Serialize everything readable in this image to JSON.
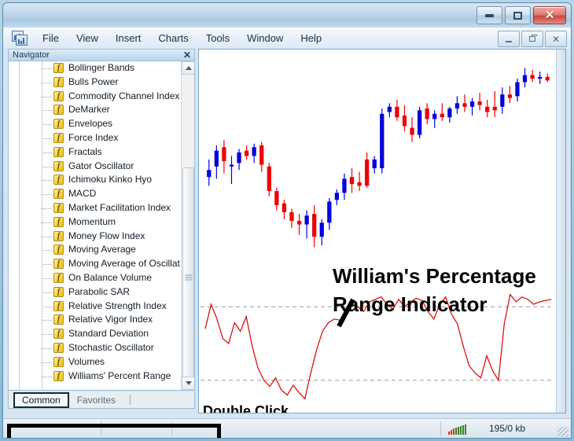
{
  "window": {
    "controls": {
      "minimize": "minimize",
      "maximize": "maximize",
      "close": "✕"
    }
  },
  "menubar": {
    "items": [
      {
        "label": "File"
      },
      {
        "label": "View"
      },
      {
        "label": "Insert"
      },
      {
        "label": "Charts"
      },
      {
        "label": "Tools"
      },
      {
        "label": "Window"
      },
      {
        "label": "Help"
      }
    ],
    "mdi_controls": {
      "minimize": "minimize",
      "restore": "restore",
      "close": "✕"
    }
  },
  "navigator": {
    "title": "Navigator",
    "close_label": "✕",
    "items": [
      {
        "label": "Bollinger Bands",
        "icon": "function-icon"
      },
      {
        "label": "Bulls Power",
        "icon": "function-icon"
      },
      {
        "label": "Commodity Channel Index",
        "icon": "function-icon"
      },
      {
        "label": "DeMarker",
        "icon": "function-icon"
      },
      {
        "label": "Envelopes",
        "icon": "function-icon"
      },
      {
        "label": "Force Index",
        "icon": "function-icon"
      },
      {
        "label": "Fractals",
        "icon": "function-icon"
      },
      {
        "label": "Gator Oscillator",
        "icon": "function-icon"
      },
      {
        "label": "Ichimoku Kinko Hyo",
        "icon": "function-icon"
      },
      {
        "label": "MACD",
        "icon": "function-icon"
      },
      {
        "label": "Market Facilitation Index",
        "icon": "function-icon"
      },
      {
        "label": "Momentum",
        "icon": "function-icon"
      },
      {
        "label": "Money Flow Index",
        "icon": "function-icon"
      },
      {
        "label": "Moving Average",
        "icon": "function-icon"
      },
      {
        "label": "Moving Average of Oscillat",
        "icon": "function-icon"
      },
      {
        "label": "On Balance Volume",
        "icon": "function-icon"
      },
      {
        "label": "Parabolic SAR",
        "icon": "function-icon"
      },
      {
        "label": "Relative Strength Index",
        "icon": "function-icon"
      },
      {
        "label": "Relative Vigor Index",
        "icon": "function-icon"
      },
      {
        "label": "Standard Deviation",
        "icon": "function-icon"
      },
      {
        "label": "Stochastic Oscillator",
        "icon": "function-icon"
      },
      {
        "label": "Volumes",
        "icon": "function-icon"
      },
      {
        "label": "Williams' Percent Range",
        "icon": "function-icon"
      }
    ],
    "tabs": [
      {
        "label": "Common",
        "active": true
      },
      {
        "label": "Favorites",
        "active": false
      }
    ]
  },
  "chart": {
    "annotations": {
      "title": "William's Percentage Range Indicator",
      "double_click": "Double Click"
    },
    "colors": {
      "bullish": "#0000dd",
      "bearish": "#ee0000",
      "indicator_line": "#dd1111",
      "level_line": "#999999"
    }
  },
  "statusbar": {
    "traffic": "195/0 kb"
  },
  "chart_data": {
    "type": "line",
    "title": "William's Percentage Range Indicator",
    "xlabel": "",
    "ylabel": "",
    "panes": [
      {
        "name": "price",
        "type": "candlestick",
        "ylim": [
          0,
          100
        ],
        "candles": [
          {
            "o": 46,
            "h": 56,
            "l": 41,
            "c": 50,
            "dir": "up"
          },
          {
            "o": 52,
            "h": 64,
            "l": 45,
            "c": 61,
            "dir": "up"
          },
          {
            "o": 63,
            "h": 67,
            "l": 48,
            "c": 55,
            "dir": "down"
          },
          {
            "o": 52,
            "h": 58,
            "l": 42,
            "c": 53,
            "dir": "up"
          },
          {
            "o": 54,
            "h": 62,
            "l": 50,
            "c": 60,
            "dir": "up"
          },
          {
            "o": 61,
            "h": 64,
            "l": 56,
            "c": 58,
            "dir": "down"
          },
          {
            "o": 58,
            "h": 65,
            "l": 54,
            "c": 63,
            "dir": "up"
          },
          {
            "o": 64,
            "h": 66,
            "l": 49,
            "c": 53,
            "dir": "down"
          },
          {
            "o": 52,
            "h": 54,
            "l": 35,
            "c": 38,
            "dir": "down"
          },
          {
            "o": 38,
            "h": 40,
            "l": 27,
            "c": 30,
            "dir": "down"
          },
          {
            "o": 31,
            "h": 33,
            "l": 22,
            "c": 26,
            "dir": "down"
          },
          {
            "o": 26,
            "h": 28,
            "l": 17,
            "c": 21,
            "dir": "down"
          },
          {
            "o": 21,
            "h": 25,
            "l": 13,
            "c": 19,
            "dir": "down"
          },
          {
            "o": 19,
            "h": 27,
            "l": 11,
            "c": 24,
            "dir": "up"
          },
          {
            "o": 25,
            "h": 30,
            "l": 6,
            "c": 12,
            "dir": "down"
          },
          {
            "o": 12,
            "h": 22,
            "l": 7,
            "c": 20,
            "dir": "up"
          },
          {
            "o": 20,
            "h": 34,
            "l": 16,
            "c": 32,
            "dir": "up"
          },
          {
            "o": 33,
            "h": 39,
            "l": 30,
            "c": 37,
            "dir": "up"
          },
          {
            "o": 37,
            "h": 48,
            "l": 33,
            "c": 45,
            "dir": "up"
          },
          {
            "o": 46,
            "h": 51,
            "l": 37,
            "c": 42,
            "dir": "down"
          },
          {
            "o": 43,
            "h": 49,
            "l": 38,
            "c": 41,
            "dir": "down"
          },
          {
            "o": 41,
            "h": 60,
            "l": 40,
            "c": 56,
            "dir": "down"
          },
          {
            "o": 56,
            "h": 58,
            "l": 48,
            "c": 51,
            "dir": "up"
          },
          {
            "o": 51,
            "h": 85,
            "l": 48,
            "c": 82,
            "dir": "up"
          },
          {
            "o": 83,
            "h": 88,
            "l": 80,
            "c": 86,
            "dir": "up"
          },
          {
            "o": 86,
            "h": 90,
            "l": 78,
            "c": 80,
            "dir": "down"
          },
          {
            "o": 81,
            "h": 87,
            "l": 72,
            "c": 75,
            "dir": "down"
          },
          {
            "o": 74,
            "h": 80,
            "l": 66,
            "c": 70,
            "dir": "down"
          },
          {
            "o": 70,
            "h": 86,
            "l": 68,
            "c": 84,
            "dir": "up"
          },
          {
            "o": 85,
            "h": 88,
            "l": 76,
            "c": 79,
            "dir": "down"
          },
          {
            "o": 79,
            "h": 84,
            "l": 74,
            "c": 82,
            "dir": "up"
          },
          {
            "o": 82,
            "h": 88,
            "l": 78,
            "c": 80,
            "dir": "down"
          },
          {
            "o": 80,
            "h": 86,
            "l": 77,
            "c": 85,
            "dir": "up"
          },
          {
            "o": 85,
            "h": 92,
            "l": 82,
            "c": 88,
            "dir": "up"
          },
          {
            "o": 88,
            "h": 93,
            "l": 83,
            "c": 86,
            "dir": "down"
          },
          {
            "o": 86,
            "h": 91,
            "l": 81,
            "c": 89,
            "dir": "up"
          },
          {
            "o": 89,
            "h": 94,
            "l": 84,
            "c": 87,
            "dir": "down"
          },
          {
            "o": 86,
            "h": 90,
            "l": 80,
            "c": 83,
            "dir": "down"
          },
          {
            "o": 84,
            "h": 95,
            "l": 80,
            "c": 86,
            "dir": "down"
          },
          {
            "o": 86,
            "h": 97,
            "l": 82,
            "c": 93,
            "dir": "up"
          },
          {
            "o": 93,
            "h": 98,
            "l": 88,
            "c": 91,
            "dir": "down"
          },
          {
            "o": 92,
            "h": 102,
            "l": 89,
            "c": 100,
            "dir": "up"
          },
          {
            "o": 100,
            "h": 108,
            "l": 97,
            "c": 104,
            "dir": "up"
          },
          {
            "o": 104,
            "h": 107,
            "l": 100,
            "c": 102,
            "dir": "down"
          },
          {
            "o": 102,
            "h": 106,
            "l": 99,
            "c": 103,
            "dir": "up"
          },
          {
            "o": 103,
            "h": 105,
            "l": 100,
            "c": 101,
            "dir": "down"
          }
        ]
      },
      {
        "name": "williams_percent_range",
        "type": "line",
        "ylim": [
          -100,
          0
        ],
        "levels": [
          -20,
          -80
        ],
        "values": [
          -38,
          -18,
          -30,
          -46,
          -50,
          -33,
          -40,
          -28,
          -52,
          -70,
          -80,
          -85,
          -78,
          -88,
          -92,
          -84,
          -90,
          -95,
          -74,
          -55,
          -40,
          -33,
          -30,
          -31,
          -22,
          -18,
          -20,
          -24,
          -16,
          -14,
          -12,
          -18,
          -22,
          -14,
          -20,
          -16,
          -13,
          -15,
          -24,
          -30,
          -18,
          -12,
          -26,
          -34,
          -52,
          -68,
          -74,
          -78,
          -60,
          -72,
          -80,
          -34,
          -10,
          -16,
          -12,
          -14,
          -18,
          -16,
          -15,
          -14
        ]
      }
    ]
  }
}
